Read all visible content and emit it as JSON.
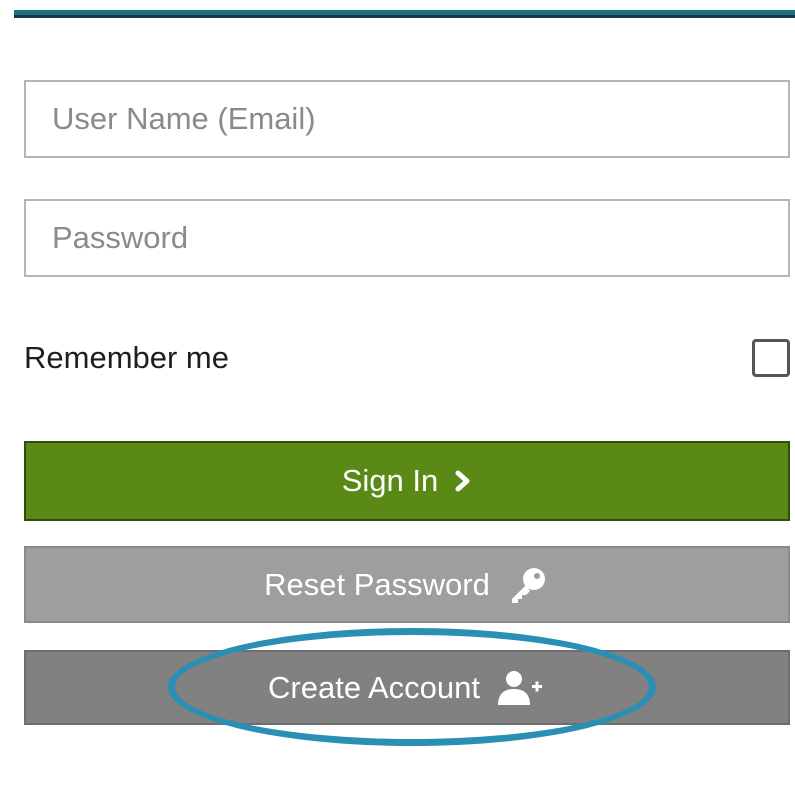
{
  "login_form": {
    "username_placeholder": "User Name (Email)",
    "username_value": "",
    "password_placeholder": "Password",
    "password_value": "",
    "remember_label": "Remember me",
    "remember_checked": false,
    "signin_label": "Sign In",
    "reset_label": "Reset Password",
    "create_label": "Create Account"
  },
  "icons": {
    "signin": "chevron-right-icon",
    "reset": "key-icon",
    "create": "add-user-icon"
  },
  "colors": {
    "accent_bar": "#1f6f82",
    "signin_bg": "#5a8a15",
    "reset_bg": "#9e9e9e",
    "create_bg": "#818181",
    "highlight": "#2a8fb5"
  }
}
